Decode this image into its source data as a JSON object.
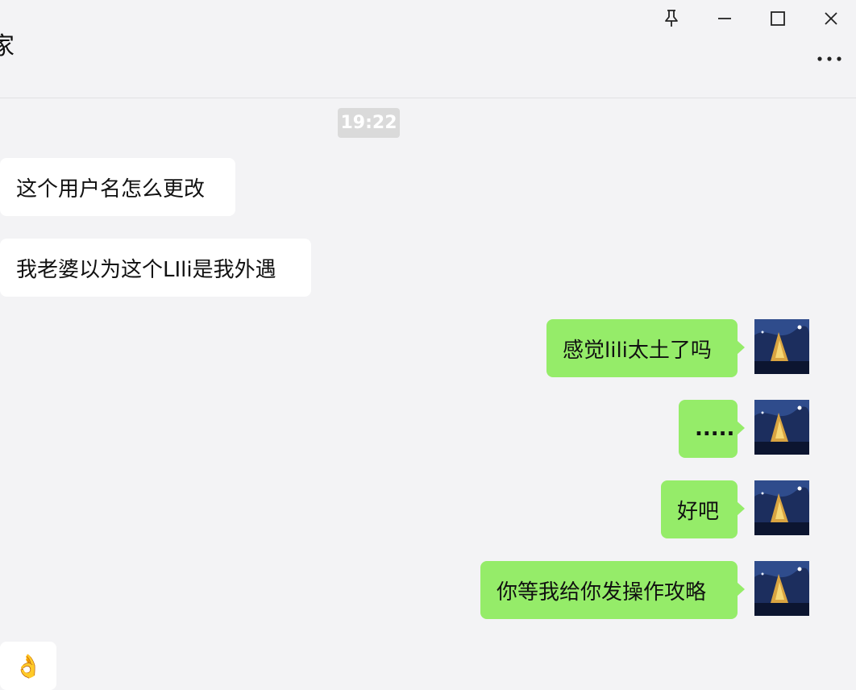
{
  "window": {
    "contact_name": "家",
    "pin_icon": "pin-icon",
    "minimize_icon": "minimize-icon",
    "maximize_icon": "maximize-icon",
    "close_icon": "close-icon",
    "more_icon": "more-icon"
  },
  "chat": {
    "timestamp": "19:22",
    "incoming": [
      {
        "text": "这个用户名怎么更改"
      },
      {
        "text": "我老婆以为这个LIli是我外遇"
      }
    ],
    "outgoing": [
      {
        "text": "感觉lili太土了吗"
      },
      {
        "text": "....."
      },
      {
        "text": "好吧"
      },
      {
        "text": "你等我给你发操作攻略"
      }
    ],
    "last_incoming_emoji": "👌"
  },
  "colors": {
    "background": "#f3f3f5",
    "incoming_bubble": "#ffffff",
    "outgoing_bubble": "#95ec69",
    "timestamp_bg": "#dadada"
  }
}
